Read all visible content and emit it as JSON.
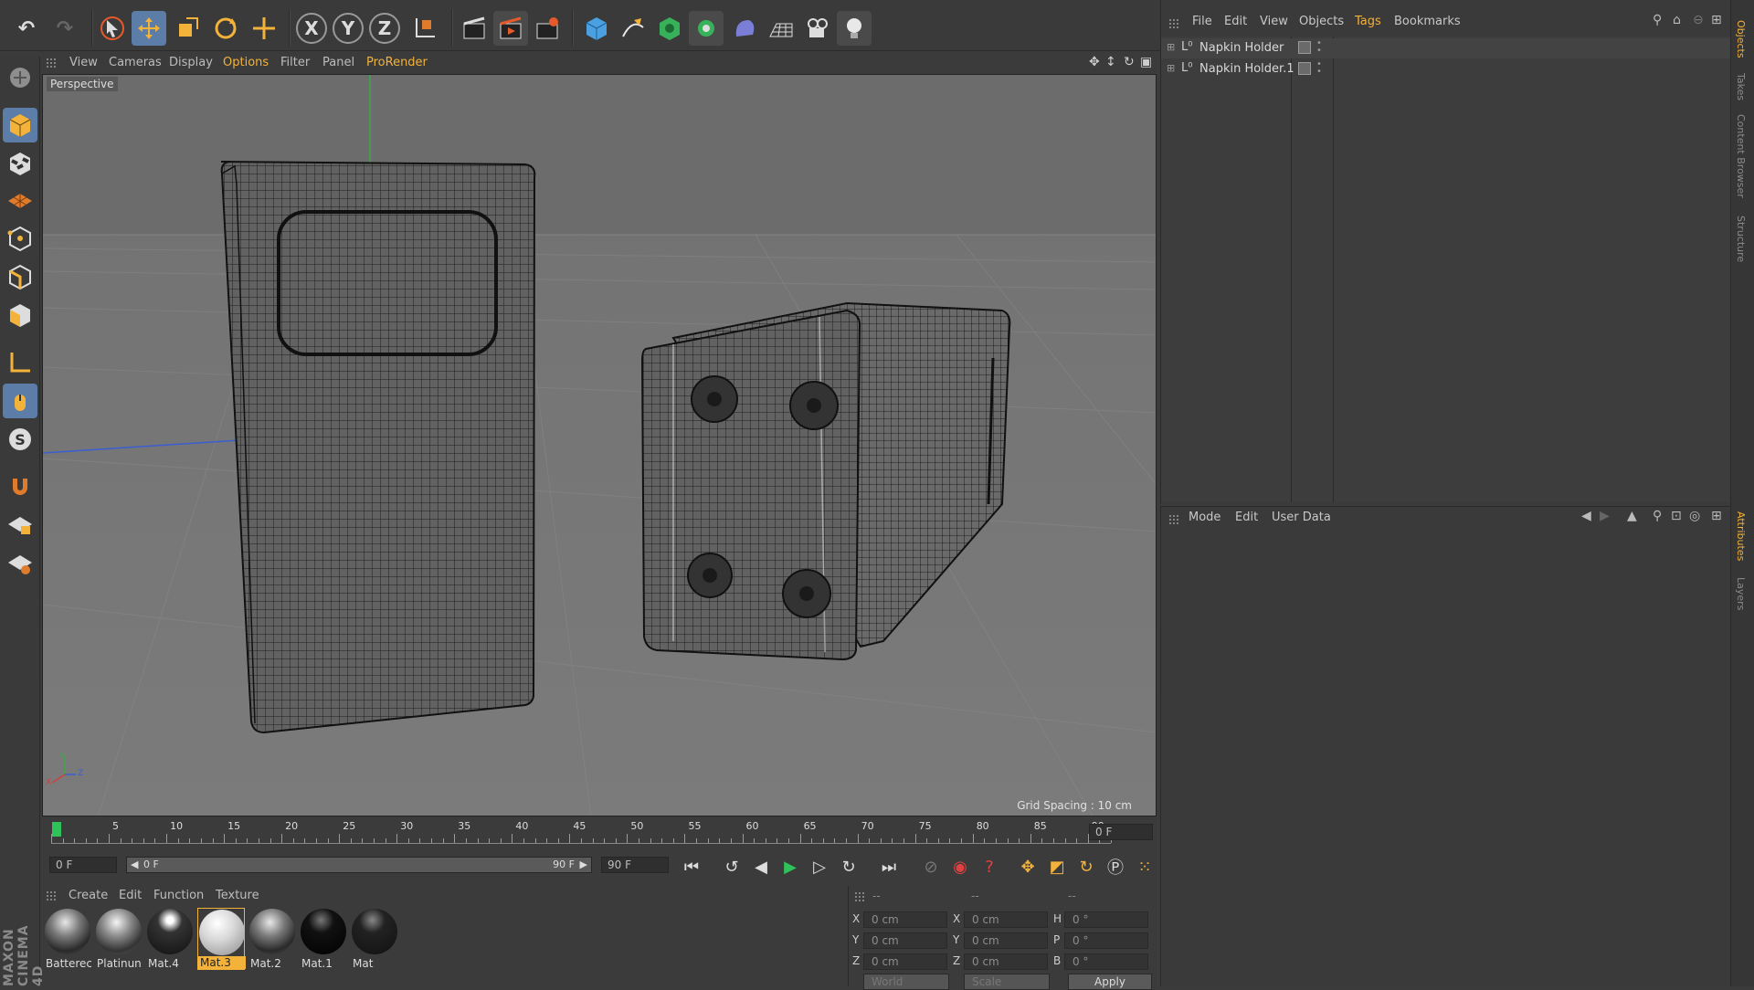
{
  "viewport": {
    "menu": [
      "View",
      "Cameras",
      "Display",
      "Options",
      "Filter",
      "Panel",
      "ProRender"
    ],
    "active_menu": "Options",
    "camera_label": "Perspective",
    "grid_spacing": "Grid Spacing : 10 cm",
    "axis_y_label": "Y",
    "axis_x_label": "X",
    "axis_z_label": "Z"
  },
  "timeline": {
    "ticks": [
      "0",
      "5",
      "10",
      "15",
      "20",
      "25",
      "30",
      "35",
      "40",
      "45",
      "50",
      "55",
      "60",
      "65",
      "70",
      "75",
      "80",
      "85",
      "90"
    ],
    "current_frame": "0 F",
    "start_field": "0 F",
    "range_start": "0 F",
    "range_end": "90 F",
    "end_field": "90 F"
  },
  "materials": {
    "menu": [
      "Create",
      "Edit",
      "Function",
      "Texture"
    ],
    "items": [
      {
        "name": "Batterec"
      },
      {
        "name": "Platinun"
      },
      {
        "name": "Mat.4"
      },
      {
        "name": "Mat.3"
      },
      {
        "name": "Mat.2"
      },
      {
        "name": "Mat.1"
      },
      {
        "name": "Mat"
      }
    ],
    "selected": "Mat.3",
    "brand_vertical": "MAXON CINEMA 4D"
  },
  "coordinates": {
    "header": [
      "--",
      "--",
      "--"
    ],
    "rows": [
      {
        "l1": "X",
        "v1": "0 cm",
        "l2": "X",
        "v2": "0 cm",
        "l3": "H",
        "v3": "0 °"
      },
      {
        "l1": "Y",
        "v1": "0 cm",
        "l2": "Y",
        "v2": "0 cm",
        "l3": "P",
        "v3": "0 °"
      },
      {
        "l1": "Z",
        "v1": "0 cm",
        "l2": "Z",
        "v2": "0 cm",
        "l3": "B",
        "v3": "0 °"
      }
    ],
    "mode_select": "World",
    "scale_select": "Scale",
    "apply_label": "Apply"
  },
  "object_manager": {
    "menu": [
      "File",
      "Edit",
      "View",
      "Objects",
      "Tags",
      "Bookmarks"
    ],
    "active_menu": "Tags",
    "objects": [
      {
        "name": "Napkin Holder"
      },
      {
        "name": "Napkin Holder.1"
      }
    ]
  },
  "attribute_manager": {
    "menu": [
      "Mode",
      "Edit",
      "User Data"
    ]
  },
  "side_tabs": {
    "top": [
      "Objects",
      "Takes",
      "Content Browser",
      "Structure"
    ],
    "bottom": [
      "Attributes",
      "Layers"
    ]
  },
  "colors": {
    "accent": "#f3b23a",
    "active_tool": "#5b7da8",
    "panel_bg": "#3a3a3a"
  }
}
